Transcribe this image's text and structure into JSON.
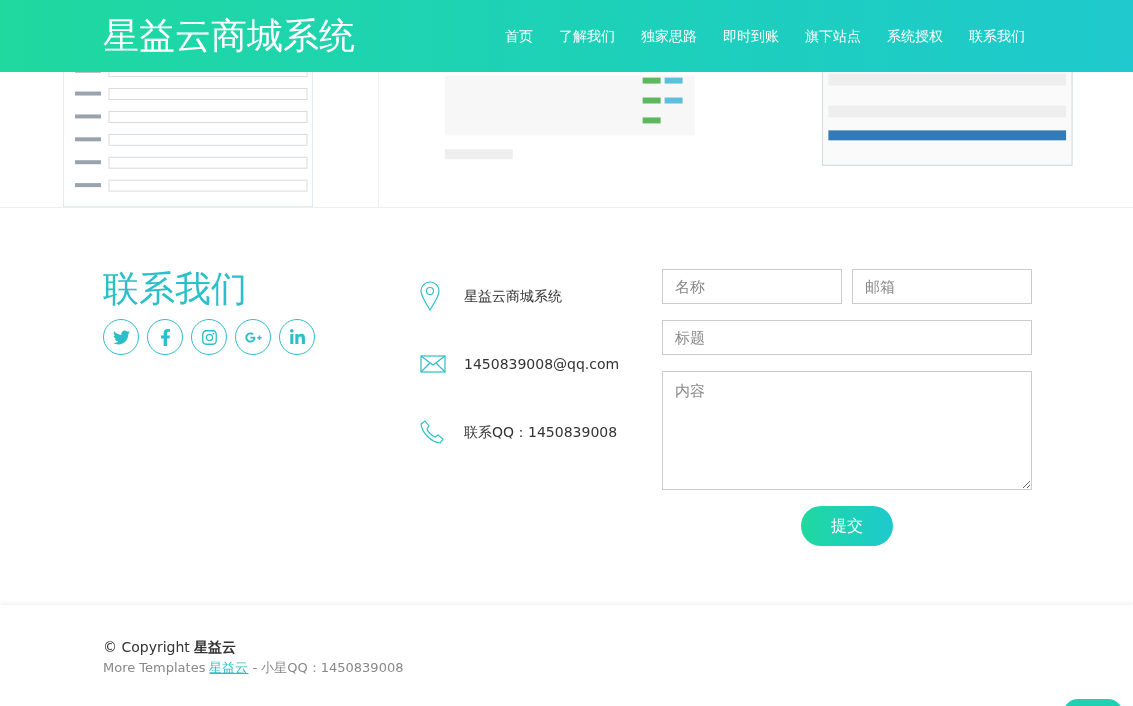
{
  "header": {
    "brand": "星益云商城系统",
    "nav": [
      {
        "label": "首页"
      },
      {
        "label": "了解我们"
      },
      {
        "label": "独家思路"
      },
      {
        "label": "即时到账"
      },
      {
        "label": "旗下站点"
      },
      {
        "label": "系统授权"
      },
      {
        "label": "联系我们"
      }
    ]
  },
  "contact": {
    "title": "联系我们",
    "items": [
      {
        "kind": "location",
        "text": "星益云商城系统"
      },
      {
        "kind": "mail",
        "text": "1450839008@qq.com"
      },
      {
        "kind": "phone",
        "text": "联系QQ：1450839008"
      }
    ],
    "form": {
      "name": {
        "placeholder": "名称"
      },
      "email": {
        "placeholder": "邮箱"
      },
      "subject": {
        "placeholder": "标题"
      },
      "message": {
        "placeholder": "内容"
      },
      "submit": "提交"
    }
  },
  "footer": {
    "copyright": "© Copyright **星益云**",
    "credit_prefix": "More Templates",
    "credit_link": "星益云",
    "credit_suffix": "- 小星QQ：1450839008"
  }
}
